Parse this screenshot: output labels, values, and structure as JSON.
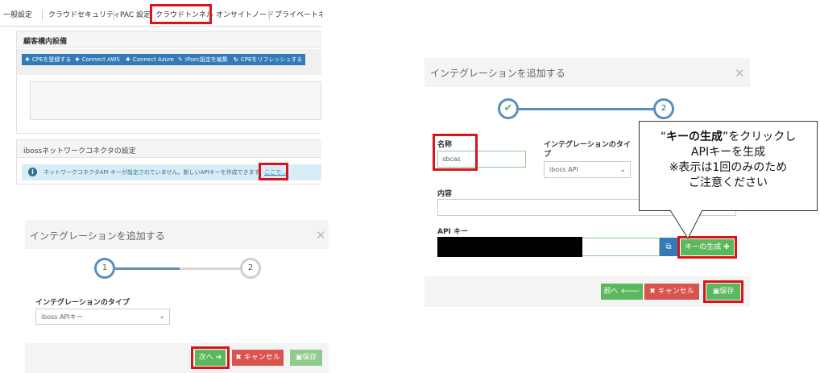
{
  "tabs": {
    "general": "一般設定",
    "cloud_security": "クラウドセキュリティ",
    "pac": "PAC 設定",
    "cloud_tunnel": "クラウドトンネル",
    "onsite_node": "オンサイトノード",
    "private": "プライベートネッ"
  },
  "customer_equipment": {
    "title": "顧客構内設備",
    "buttons": {
      "register_cpe": "CPEを登録する",
      "connect_aws": "Connect AWS",
      "connect_azure": "Connect Azure",
      "edit_ipsec": "IPsec設定を編集",
      "refresh_cpe": "CPEをリフレッシュする"
    }
  },
  "connector_settings": {
    "title": "ibossネットワークコネクタの設定",
    "info_text": "ネットワークコネクタAPI キーが設定されていません。新しいAPIキーを作成できます",
    "link_text": "ここで..."
  },
  "modal_step1": {
    "title": "インテグレーションを追加する",
    "step1": "1",
    "step2": "2",
    "type_label": "インテグレーションのタイプ",
    "type_value": "iboss APIキー",
    "next_button": "次へ",
    "cancel_button": "キャンセル",
    "save_button": "保存"
  },
  "modal_step2": {
    "title": "インテグレーションを追加する",
    "step2": "2",
    "name_label": "名称",
    "name_value": "sbcas",
    "type_label_line1": "インテグレーションのタイ",
    "type_label_line2": "プ",
    "type_value": "iboss API",
    "content_label": "内容",
    "api_key_label": "API キー",
    "generate_button": "キーの生成",
    "prev_button": "前へ",
    "cancel_button": "キャンセル",
    "save_button": "保存"
  },
  "callout": {
    "bold": "キーの生成",
    "line1_rest": "をクリックし",
    "line2": "APIキーを生成",
    "line3": "※表示は1回のみのため",
    "line4": "ご注意ください"
  },
  "colors": {
    "highlight": "#d9141c",
    "primary": "#337ab7",
    "success": "#5cb85c",
    "danger": "#d9534f",
    "step_active": "#5b8fba"
  }
}
